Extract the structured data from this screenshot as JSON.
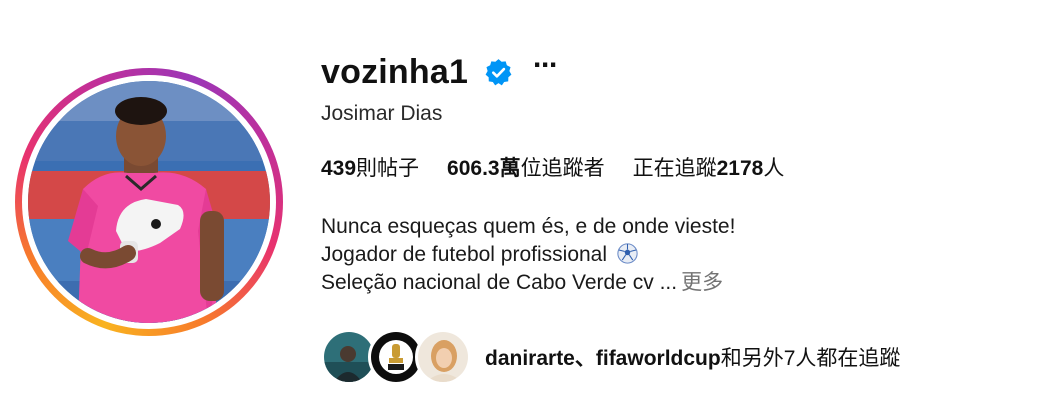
{
  "profile": {
    "username": "vozinha1",
    "full_name": "Josimar Dias",
    "stats": {
      "posts_count": "439",
      "posts_label": "則帖子",
      "followers_count": "606.3萬",
      "followers_label": "位追蹤者",
      "following_prefix": "正在追蹤",
      "following_count": "2178",
      "following_suffix": "人"
    },
    "bio": {
      "line1": "Nunca esqueças quem és, e de onde vieste!",
      "line2": "Jogador de futebol profissional",
      "line3": "Seleção nacional de Cabo Verde cv ...",
      "more_label": "更多"
    },
    "followed_by": {
      "names": "danirarte、fifaworldcup",
      "suffix": "和另外7人都在追蹤"
    }
  },
  "icons": {
    "verified": "verified-badge-icon",
    "more": "more-options-icon",
    "ball": "soccer-ball-icon"
  },
  "colors": {
    "verified_blue": "#0095f6",
    "muted_text": "#737373",
    "jersey_pink": "#f04aa2"
  }
}
